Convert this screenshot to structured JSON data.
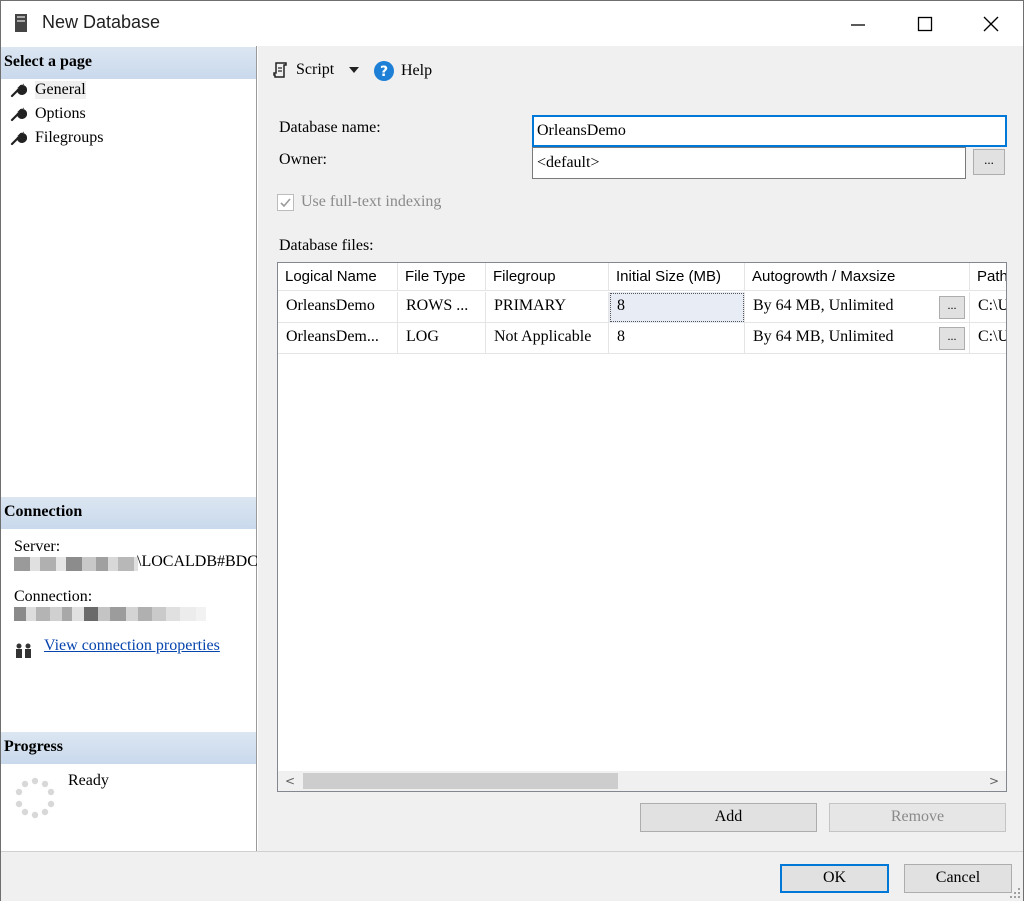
{
  "window": {
    "title": "New Database",
    "icons": {
      "app": "database-icon",
      "minimize": "minimize-icon",
      "maximize": "maximize-icon",
      "close": "close-icon"
    }
  },
  "left": {
    "select_page_header": "Select a page",
    "pages": [
      {
        "label": "General",
        "icon": "wrench-icon",
        "selected": true
      },
      {
        "label": "Options",
        "icon": "wrench-icon",
        "selected": false
      },
      {
        "label": "Filegroups",
        "icon": "wrench-icon",
        "selected": false
      }
    ],
    "connection_header": "Connection",
    "server_label": "Server:",
    "server_value_suffix": "\\LOCALDB#BDC",
    "connection_label": "Connection:",
    "view_connection_link": "View connection properties",
    "progress_header": "Progress",
    "progress_status": "Ready"
  },
  "toolbar": {
    "script_label": "Script",
    "help_label": "Help"
  },
  "form": {
    "database_name_label": "Database name:",
    "database_name_value": "OrleansDemo",
    "owner_label": "Owner:",
    "owner_value": "<default>",
    "browse_label": "...",
    "fulltext_label": "Use full-text indexing",
    "fulltext_checked": true,
    "database_files_label": "Database files:"
  },
  "grid": {
    "columns": [
      "Logical Name",
      "File Type",
      "Filegroup",
      "Initial Size (MB)",
      "Autogrowth / Maxsize",
      "Path"
    ],
    "rows": [
      [
        "OrleansDemo",
        "ROWS ...",
        "PRIMARY",
        "8",
        "By 64 MB, Unlimited",
        "C:\\U"
      ],
      [
        "OrleansDem...",
        "LOG",
        "Not Applicable",
        "8",
        "By 64 MB, Unlimited",
        "C:\\U"
      ]
    ],
    "cell_button_label": "...",
    "scroll_left": "<",
    "scroll_right": ">"
  },
  "buttons": {
    "add": "Add",
    "remove": "Remove",
    "ok": "OK",
    "cancel": "Cancel"
  },
  "colors": {
    "accent": "#0078d7",
    "link": "#0645ad",
    "header_band": "#c9d9ec"
  }
}
